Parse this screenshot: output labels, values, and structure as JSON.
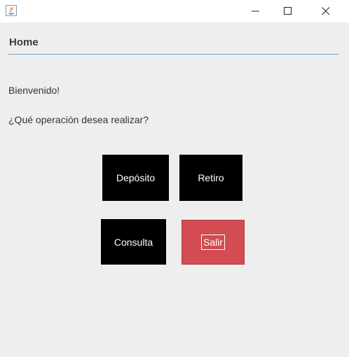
{
  "window": {
    "icons": {
      "app": "java-coffee-icon",
      "minimize": "minimize-icon",
      "maximize": "maximize-icon",
      "close": "close-icon"
    }
  },
  "header": {
    "title": "Home"
  },
  "main": {
    "welcome_text": "Bienvenido!",
    "question_text": "¿Qué operación desea realizar?"
  },
  "buttons": {
    "deposito": "Depósito",
    "retiro": "Retiro",
    "consulta": "Consulta",
    "salir": "Salir"
  },
  "colors": {
    "button_dark": "#000000",
    "button_exit": "#d24c52",
    "rule": "#7a9cc6",
    "background": "#eeeeee"
  }
}
